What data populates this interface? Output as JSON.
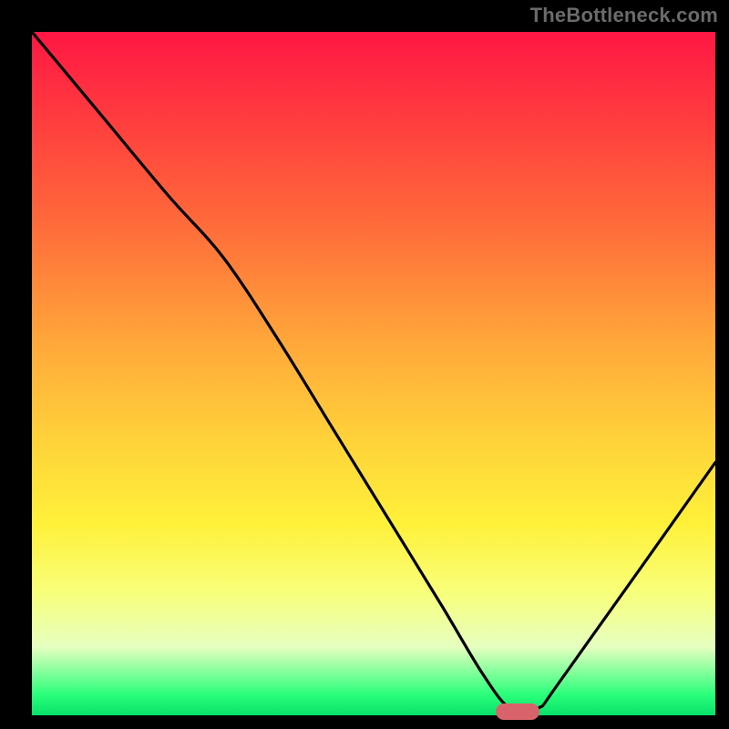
{
  "watermark": "TheBottleneck.com",
  "chart_data": {
    "type": "line",
    "title": "",
    "xlabel": "",
    "ylabel": "",
    "xlim": [
      0,
      100
    ],
    "ylim": [
      0,
      100
    ],
    "grid": false,
    "legend": false,
    "series": [
      {
        "name": "bottleneck-curve",
        "x": [
          0,
          10,
          20,
          28,
          36,
          44,
          52,
          60,
          66,
          70,
          74,
          78,
          100
        ],
        "y": [
          100,
          88,
          76,
          67,
          55,
          42,
          29,
          16,
          6,
          1,
          1,
          6,
          37
        ]
      }
    ],
    "marker": {
      "x": 71,
      "y": 0.5,
      "color": "#d9636b"
    },
    "gradient_stops": [
      {
        "pos": 0.0,
        "color": "#ff1744"
      },
      {
        "pos": 0.28,
        "color": "#ff6a3a"
      },
      {
        "pos": 0.6,
        "color": "#ffd33a"
      },
      {
        "pos": 0.82,
        "color": "#f8ff7a"
      },
      {
        "pos": 1.0,
        "color": "#08e06a"
      }
    ]
  }
}
